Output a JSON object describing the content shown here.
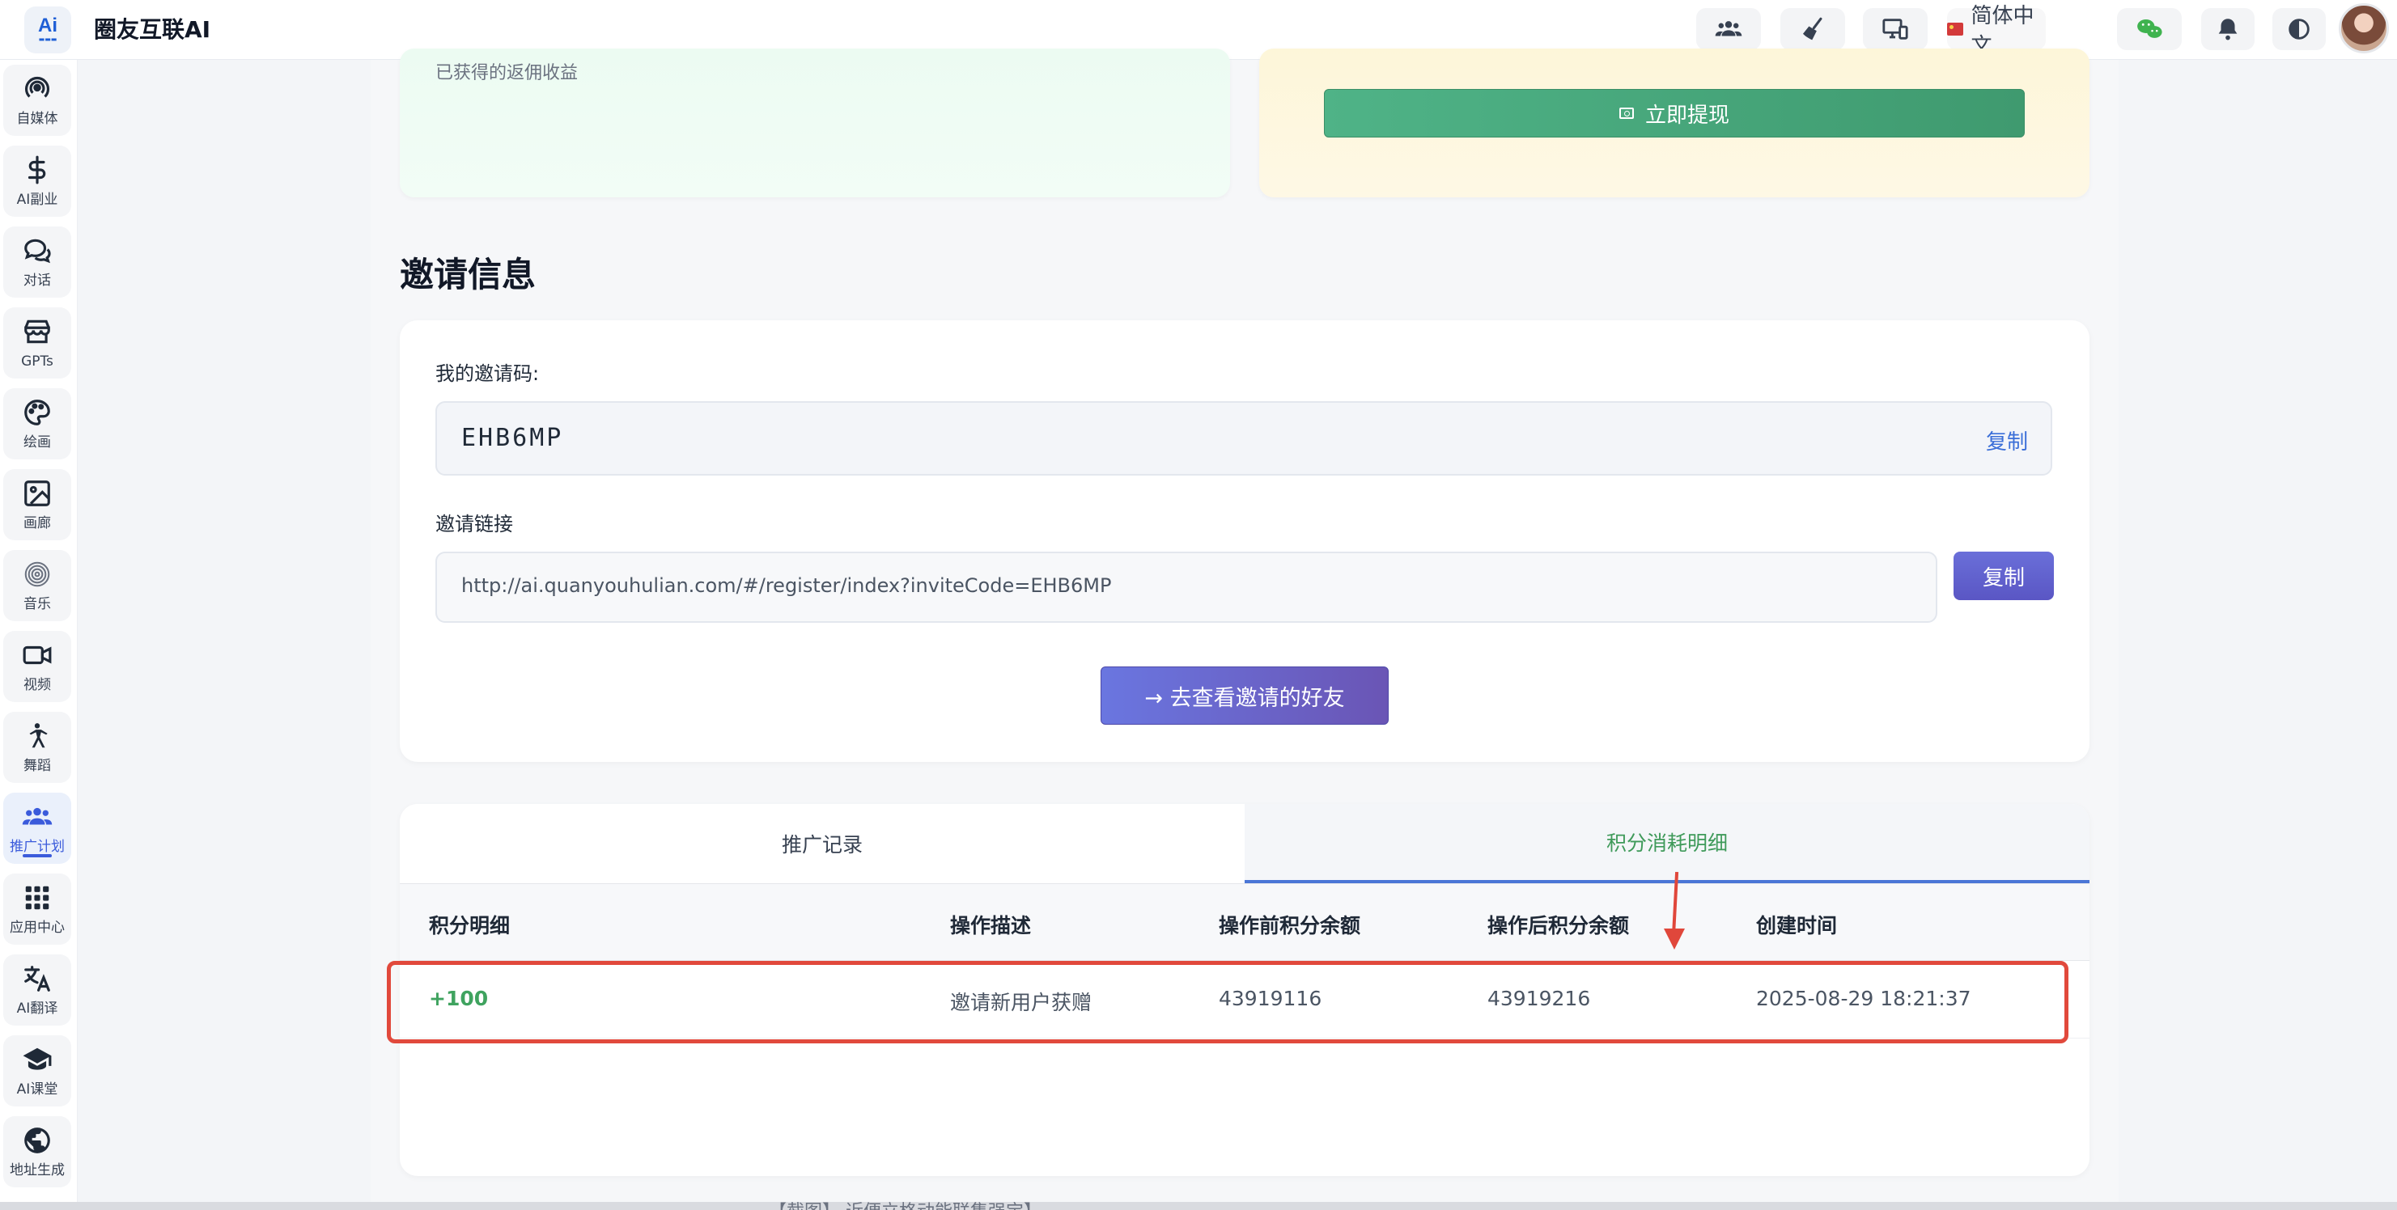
{
  "header": {
    "logo_text": "Ai",
    "app_title": "圈友互联AI",
    "language": "简体中文"
  },
  "sidebar": {
    "items": [
      {
        "label": "自媒体",
        "icon": "broadcast-icon"
      },
      {
        "label": "AI副业",
        "icon": "dollar-icon"
      },
      {
        "label": "对话",
        "icon": "chat-icon"
      },
      {
        "label": "GPTs",
        "icon": "store-icon"
      },
      {
        "label": "绘画",
        "icon": "palette-icon"
      },
      {
        "label": "画廊",
        "icon": "image-icon"
      },
      {
        "label": "音乐",
        "icon": "music-disc-icon"
      },
      {
        "label": "视频",
        "icon": "video-icon"
      },
      {
        "label": "舞蹈",
        "icon": "dance-icon"
      },
      {
        "label": "推广计划",
        "icon": "users-icon",
        "active": true
      },
      {
        "label": "应用中心",
        "icon": "grid-icon"
      },
      {
        "label": "AI翻译",
        "icon": "translate-icon"
      },
      {
        "label": "AI课堂",
        "icon": "graduation-cap-icon"
      },
      {
        "label": "地址生成",
        "icon": "globe-icon"
      }
    ]
  },
  "earnings": {
    "caption": "已获得的返佣收益"
  },
  "withdraw": {
    "button_label": "立即提现"
  },
  "invite": {
    "section_title": "邀请信息",
    "code_label": "我的邀请码:",
    "code_value": "EHB6MP",
    "code_copy": "复制",
    "link_label": "邀请链接",
    "link_value": "http://ai.quanyouhulian.com/#/register/index?inviteCode=EHB6MP",
    "link_copy": "复制",
    "view_friends": "→ 去查看邀请的好友"
  },
  "records": {
    "tabs": [
      "推广记录",
      "积分消耗明细"
    ],
    "active_tab": 1,
    "columns": [
      "积分明细",
      "操作描述",
      "操作前积分余额",
      "操作后积分余额",
      "创建时间"
    ],
    "rows": [
      [
        "+100",
        "邀请新用户获赠",
        "43919116",
        "43919216",
        "2025-08-29 18:21:37"
      ]
    ]
  },
  "colors": {
    "accent": "#5a56c4",
    "success": "#3fa35f",
    "highlight": "#e1493c",
    "link_blue": "#3b6fd8"
  },
  "footer_partial_text": "【截图】 近便立格动能联集强宝】"
}
